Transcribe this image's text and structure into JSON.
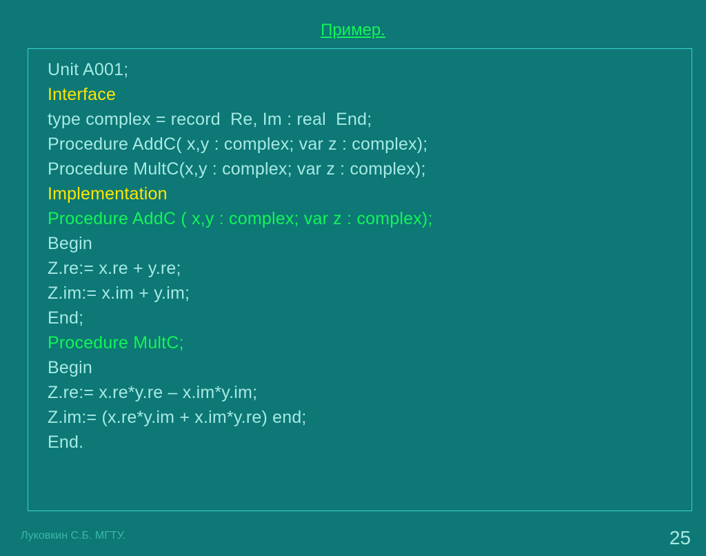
{
  "title": "Пример.",
  "code": {
    "l1": "Unit A001;",
    "l2": "Interface",
    "l3": "type complex = record  Re, Im : real  End;",
    "l4": "Procedure AddC( x,y : complex; var z : complex);",
    "l5": "Procedure MultC(x,y : complex; var z : complex);",
    "l6": "Implementation",
    "l7": "Procedure AddC ( x,y : complex; var z : complex);",
    "l8": "Begin",
    "l9": "Z.re:= x.re + y.re;",
    "l10": "Z.im:= x.im + y.im;",
    "l11": "End;",
    "l12": "Procedure MultC;",
    "l13": "Begin",
    "l14": "Z.re:= x.re*y.re – x.im*y.im;",
    "l15": "Z.im:= (x.re*y.im + x.im*y.re) end;",
    "l16": "End."
  },
  "author": "Луковкин С.Б. МГТУ.",
  "page": "25"
}
